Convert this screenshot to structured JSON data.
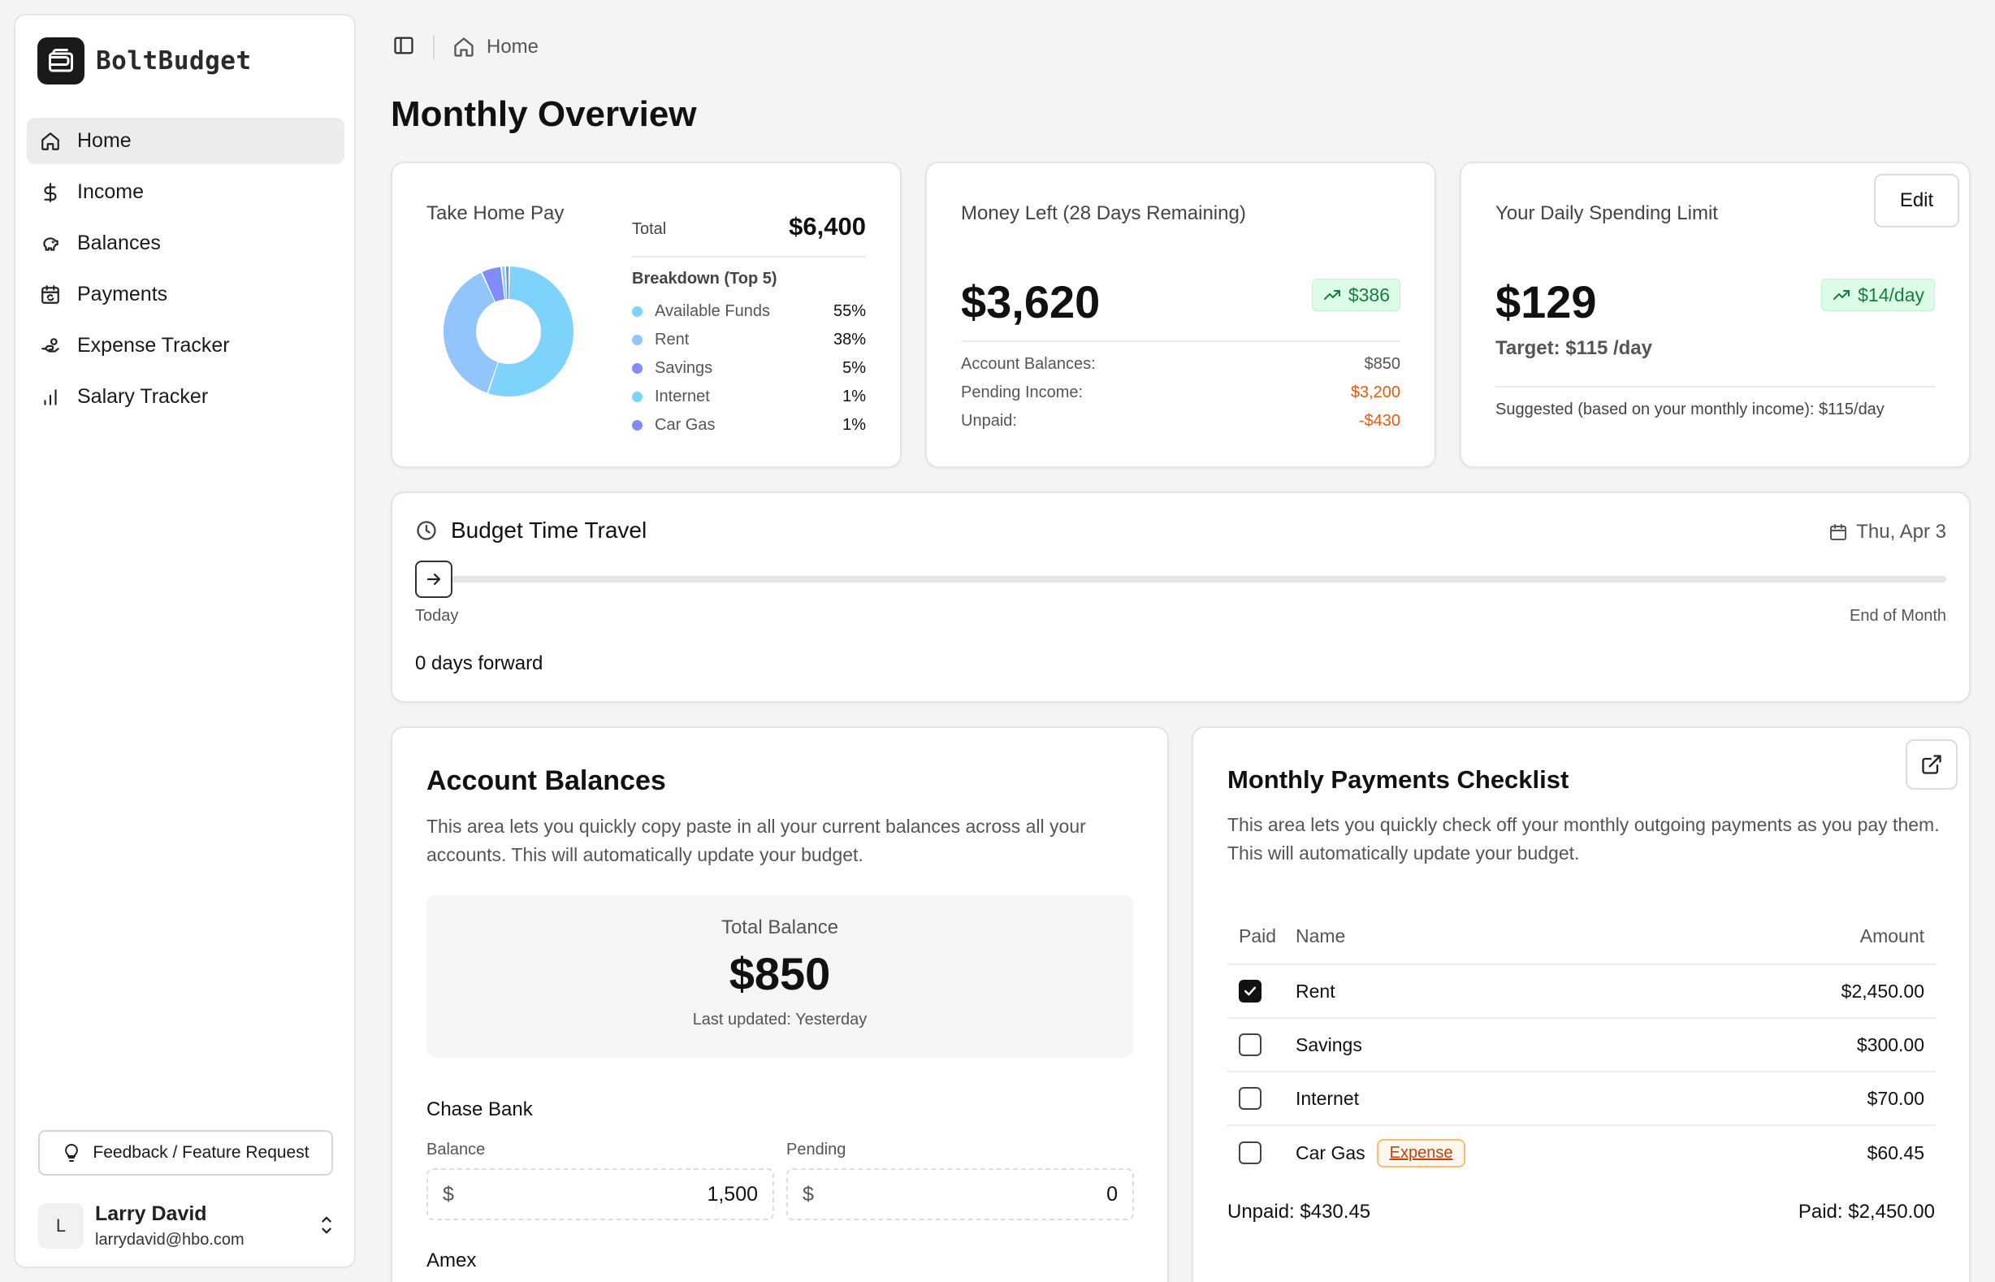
{
  "app": {
    "name": "BoltBudget"
  },
  "sidebar": {
    "items": [
      {
        "label": "Home",
        "icon": "home-icon",
        "active": true
      },
      {
        "label": "Income",
        "icon": "dollar-icon"
      },
      {
        "label": "Balances",
        "icon": "piggy-bank-icon"
      },
      {
        "label": "Payments",
        "icon": "calendar-sync-icon"
      },
      {
        "label": "Expense Tracker",
        "icon": "hand-coins-icon"
      },
      {
        "label": "Salary Tracker",
        "icon": "bar-chart-icon"
      }
    ],
    "feedback_label": "Feedback / Feature Request",
    "user": {
      "initial": "L",
      "name": "Larry David",
      "email": "larrydavid@hbo.com"
    }
  },
  "header": {
    "breadcrumb": "Home",
    "title": "Monthly Overview"
  },
  "take_home": {
    "label": "Take Home Pay",
    "total_label": "Total",
    "total_value": "$6,400",
    "breakdown_title": "Breakdown (Top 5)",
    "items": [
      {
        "name": "Available Funds",
        "pct": "55%",
        "value": 55,
        "color": "#7dd3fc"
      },
      {
        "name": "Rent",
        "pct": "38%",
        "value": 38,
        "color": "#93c5fd"
      },
      {
        "name": "Savings",
        "pct": "5%",
        "value": 5,
        "color": "#818cf8"
      },
      {
        "name": "Internet",
        "pct": "1%",
        "value": 1,
        "color": "#7dd3fc"
      },
      {
        "name": "Car Gas",
        "pct": "1%",
        "value": 1,
        "color": "#818cf8"
      }
    ]
  },
  "money_left": {
    "label": "Money Left (28 Days Remaining)",
    "value": "$3,620",
    "badge": "$386",
    "rows": [
      {
        "label": "Account Balances:",
        "value": "$850"
      },
      {
        "label": "Pending Income:",
        "value": "$3,200"
      },
      {
        "label": "Unpaid:",
        "value": "-$430"
      }
    ]
  },
  "daily_limit": {
    "label": "Your Daily Spending Limit",
    "edit_label": "Edit",
    "value": "$129",
    "badge": "$14/day",
    "target": "Target: $115 /day",
    "suggested": "Suggested (based on your monthly income): $115/day"
  },
  "time_travel": {
    "title": "Budget Time Travel",
    "date": "Thu, Apr 3",
    "start_label": "Today",
    "end_label": "End of Month",
    "days_label": "0 days forward",
    "progress": 0
  },
  "account_balances": {
    "title": "Account Balances",
    "description": "This area lets you quickly copy paste in all your current balances across all your accounts. This will automatically update your budget.",
    "total_label": "Total Balance",
    "total_value": "$850",
    "updated": "Last updated: Yesterday",
    "accounts": [
      {
        "name": "Chase Bank",
        "balance_label": "Balance",
        "pending_label": "Pending",
        "currency": "$",
        "balance": "1,500",
        "pending": "0"
      },
      {
        "name": "Amex"
      }
    ]
  },
  "payments": {
    "title": "Monthly Payments Checklist",
    "description": "This area lets you quickly check off your monthly outgoing payments as you pay them. This will automatically update your budget.",
    "headers": {
      "paid": "Paid",
      "name": "Name",
      "amount": "Amount"
    },
    "rows": [
      {
        "name": "Rent",
        "amount": "$2,450.00",
        "paid": true,
        "tag": ""
      },
      {
        "name": "Savings",
        "amount": "$300.00",
        "paid": false,
        "tag": ""
      },
      {
        "name": "Internet",
        "amount": "$70.00",
        "paid": false,
        "tag": ""
      },
      {
        "name": "Car Gas",
        "amount": "$60.45",
        "paid": false,
        "tag": "Expense"
      }
    ],
    "unpaid": "Unpaid: $430.45",
    "paid_total": "Paid: $2,450.00"
  }
}
